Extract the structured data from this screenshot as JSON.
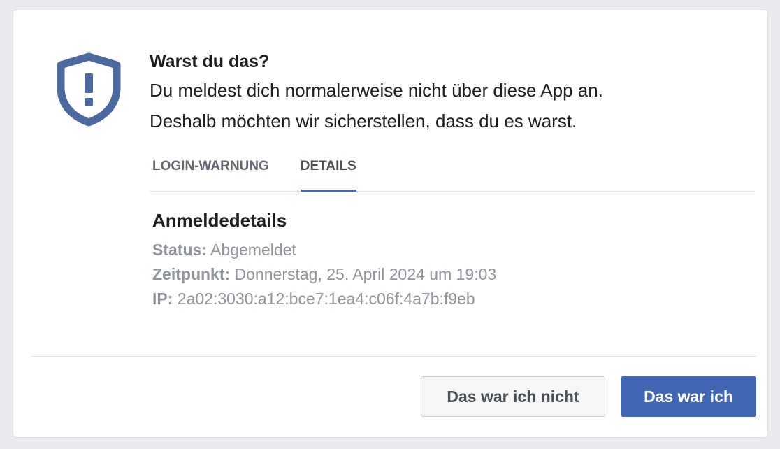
{
  "dialog": {
    "title": "Warst du das?",
    "description_line1": "Du meldest dich normalerweise nicht über diese App an.",
    "description_line2": "Deshalb möchten wir sicherstellen, dass du es warst.",
    "icon": "shield-warning-icon",
    "accent_color": "#4267b2"
  },
  "tabs": [
    {
      "label": "LOGIN-WARNUNG",
      "active": false
    },
    {
      "label": "DETAILS",
      "active": true
    }
  ],
  "details": {
    "title": "Anmeldedetails",
    "status_label": "Status:",
    "status_value": "Abgemeldet",
    "time_label": "Zeitpunkt:",
    "time_value": "Donnerstag, 25. April 2024 um 19:03",
    "ip_label": "IP:",
    "ip_value": "2a02:3030:a12:bce7:1ea4:c06f:4a7b:f9eb"
  },
  "buttons": {
    "secondary_label": "Das war ich nicht",
    "primary_label": "Das war ich"
  }
}
